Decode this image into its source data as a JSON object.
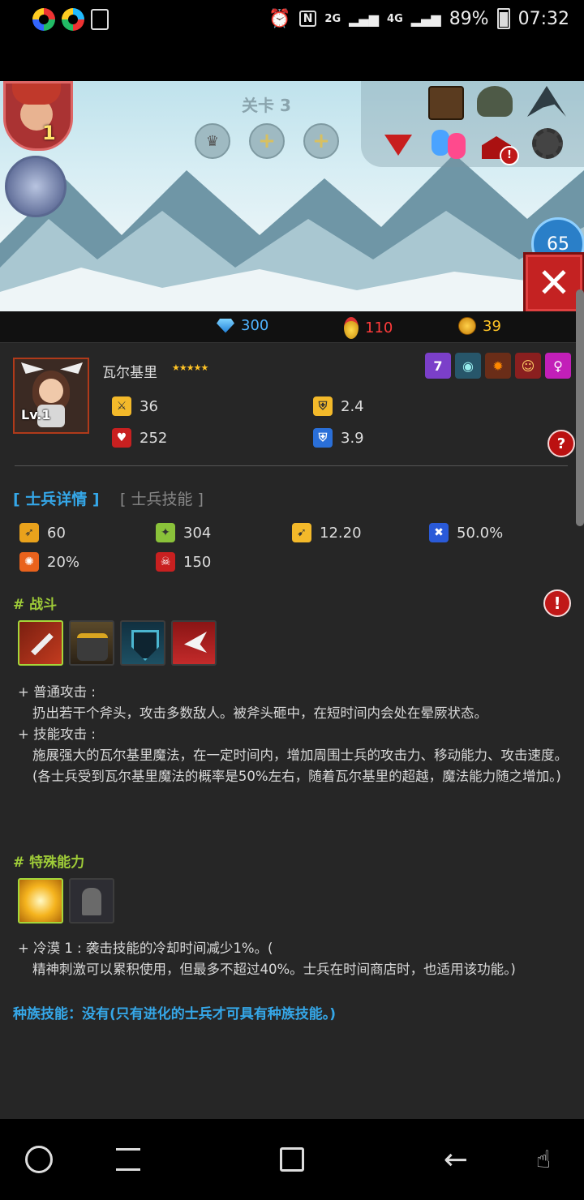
{
  "status_bar": {
    "network_small": "2G",
    "network_4g": "4G",
    "battery": "89%",
    "time": "07:32"
  },
  "game": {
    "level_label": "关卡 3",
    "hero_level": "1",
    "timer": "65"
  },
  "resources": {
    "gems": "300",
    "medals": "110",
    "coins": "39"
  },
  "unit": {
    "name": "瓦尔基里",
    "stars": "★★★★★",
    "level": "Lv.1",
    "attack": "36",
    "hp": "252",
    "armor": "2.4",
    "magic_resist": "3.9",
    "badge_count": "7"
  },
  "tabs": {
    "details": "[ 士兵详情 ]",
    "skills": "[ 士兵技能 ]"
  },
  "attributes": {
    "a1": "60",
    "a2": "304",
    "a3": "12.20",
    "a4": "50.0%",
    "a5": "20%",
    "a6": "150"
  },
  "combat": {
    "header": "# 战斗",
    "normal_title": "+ 普通攻击 :",
    "normal_text": "扔出若干个斧头，攻击多数敌人。被斧头砸中，在短时间内会处在晕厥状态。",
    "skill_title": "+ 技能攻击 :",
    "skill_text": "施展强大的瓦尔基里魔法，在一定时间内，增加周围士兵的攻击力、移动能力、攻击速度。",
    "skill_note": "(各士兵受到瓦尔基里魔法的概率是50%左右，随着瓦尔基里的超越，魔法能力随之增加。)"
  },
  "special": {
    "header": "# 特殊能力",
    "line1": "+ 冷漠 1 : 袭击技能的冷却时间减少1%。(",
    "line2": "精神刺激可以累积使用，但最多不超过40%。士兵在时间商店时，也适用该功能。)"
  },
  "race_skill": "种族技能：没有(只有进化的士兵才可具有种族技能。)",
  "colors": {
    "accent_blue": "#35a7e8",
    "section_green": "#9fcc38",
    "panel_bg": "#262626",
    "close_red": "#c42222"
  }
}
